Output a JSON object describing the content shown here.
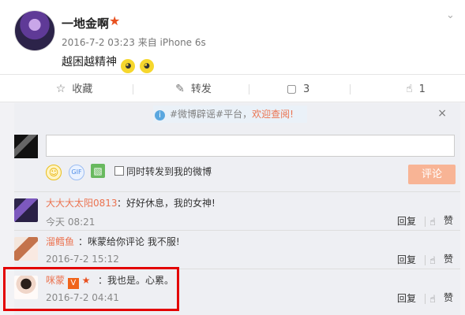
{
  "post": {
    "username": "一地金啊",
    "user_badge_icon": "fire-emoji-icon",
    "date": "2016-7-2 03:23",
    "source_prefix": "来自",
    "source": "iPhone 6s",
    "text": "越困越精神"
  },
  "actions": {
    "favorite": "收藏",
    "repost": "转发",
    "comment_count": "3",
    "like_count": "1"
  },
  "notice": {
    "hashtag": "#微博辟谣#平台，",
    "link": "欢迎查阅!"
  },
  "composer": {
    "repost_label": "同时转发到我的微博",
    "submit_label": "评论"
  },
  "comments": [
    {
      "username": "大大大太阳0813",
      "text": "：好好休息，我的女神!",
      "time": "今天 08:21",
      "reply": "回复",
      "like": "赞"
    },
    {
      "username": "溜鳕鱼",
      "text": "：咪蒙给你评论 我不服!",
      "time": "2016-7-2 15:12",
      "reply": "回复",
      "like": "赞"
    },
    {
      "username": "咪蒙",
      "badge": "V",
      "text": "：我也是。心累。",
      "time": "2016-7-2 04:41",
      "reply": "回复",
      "like": "赞"
    }
  ],
  "colors": {
    "link": "#eb7350",
    "highlight": "#e30000",
    "submit": "#f8b495"
  }
}
